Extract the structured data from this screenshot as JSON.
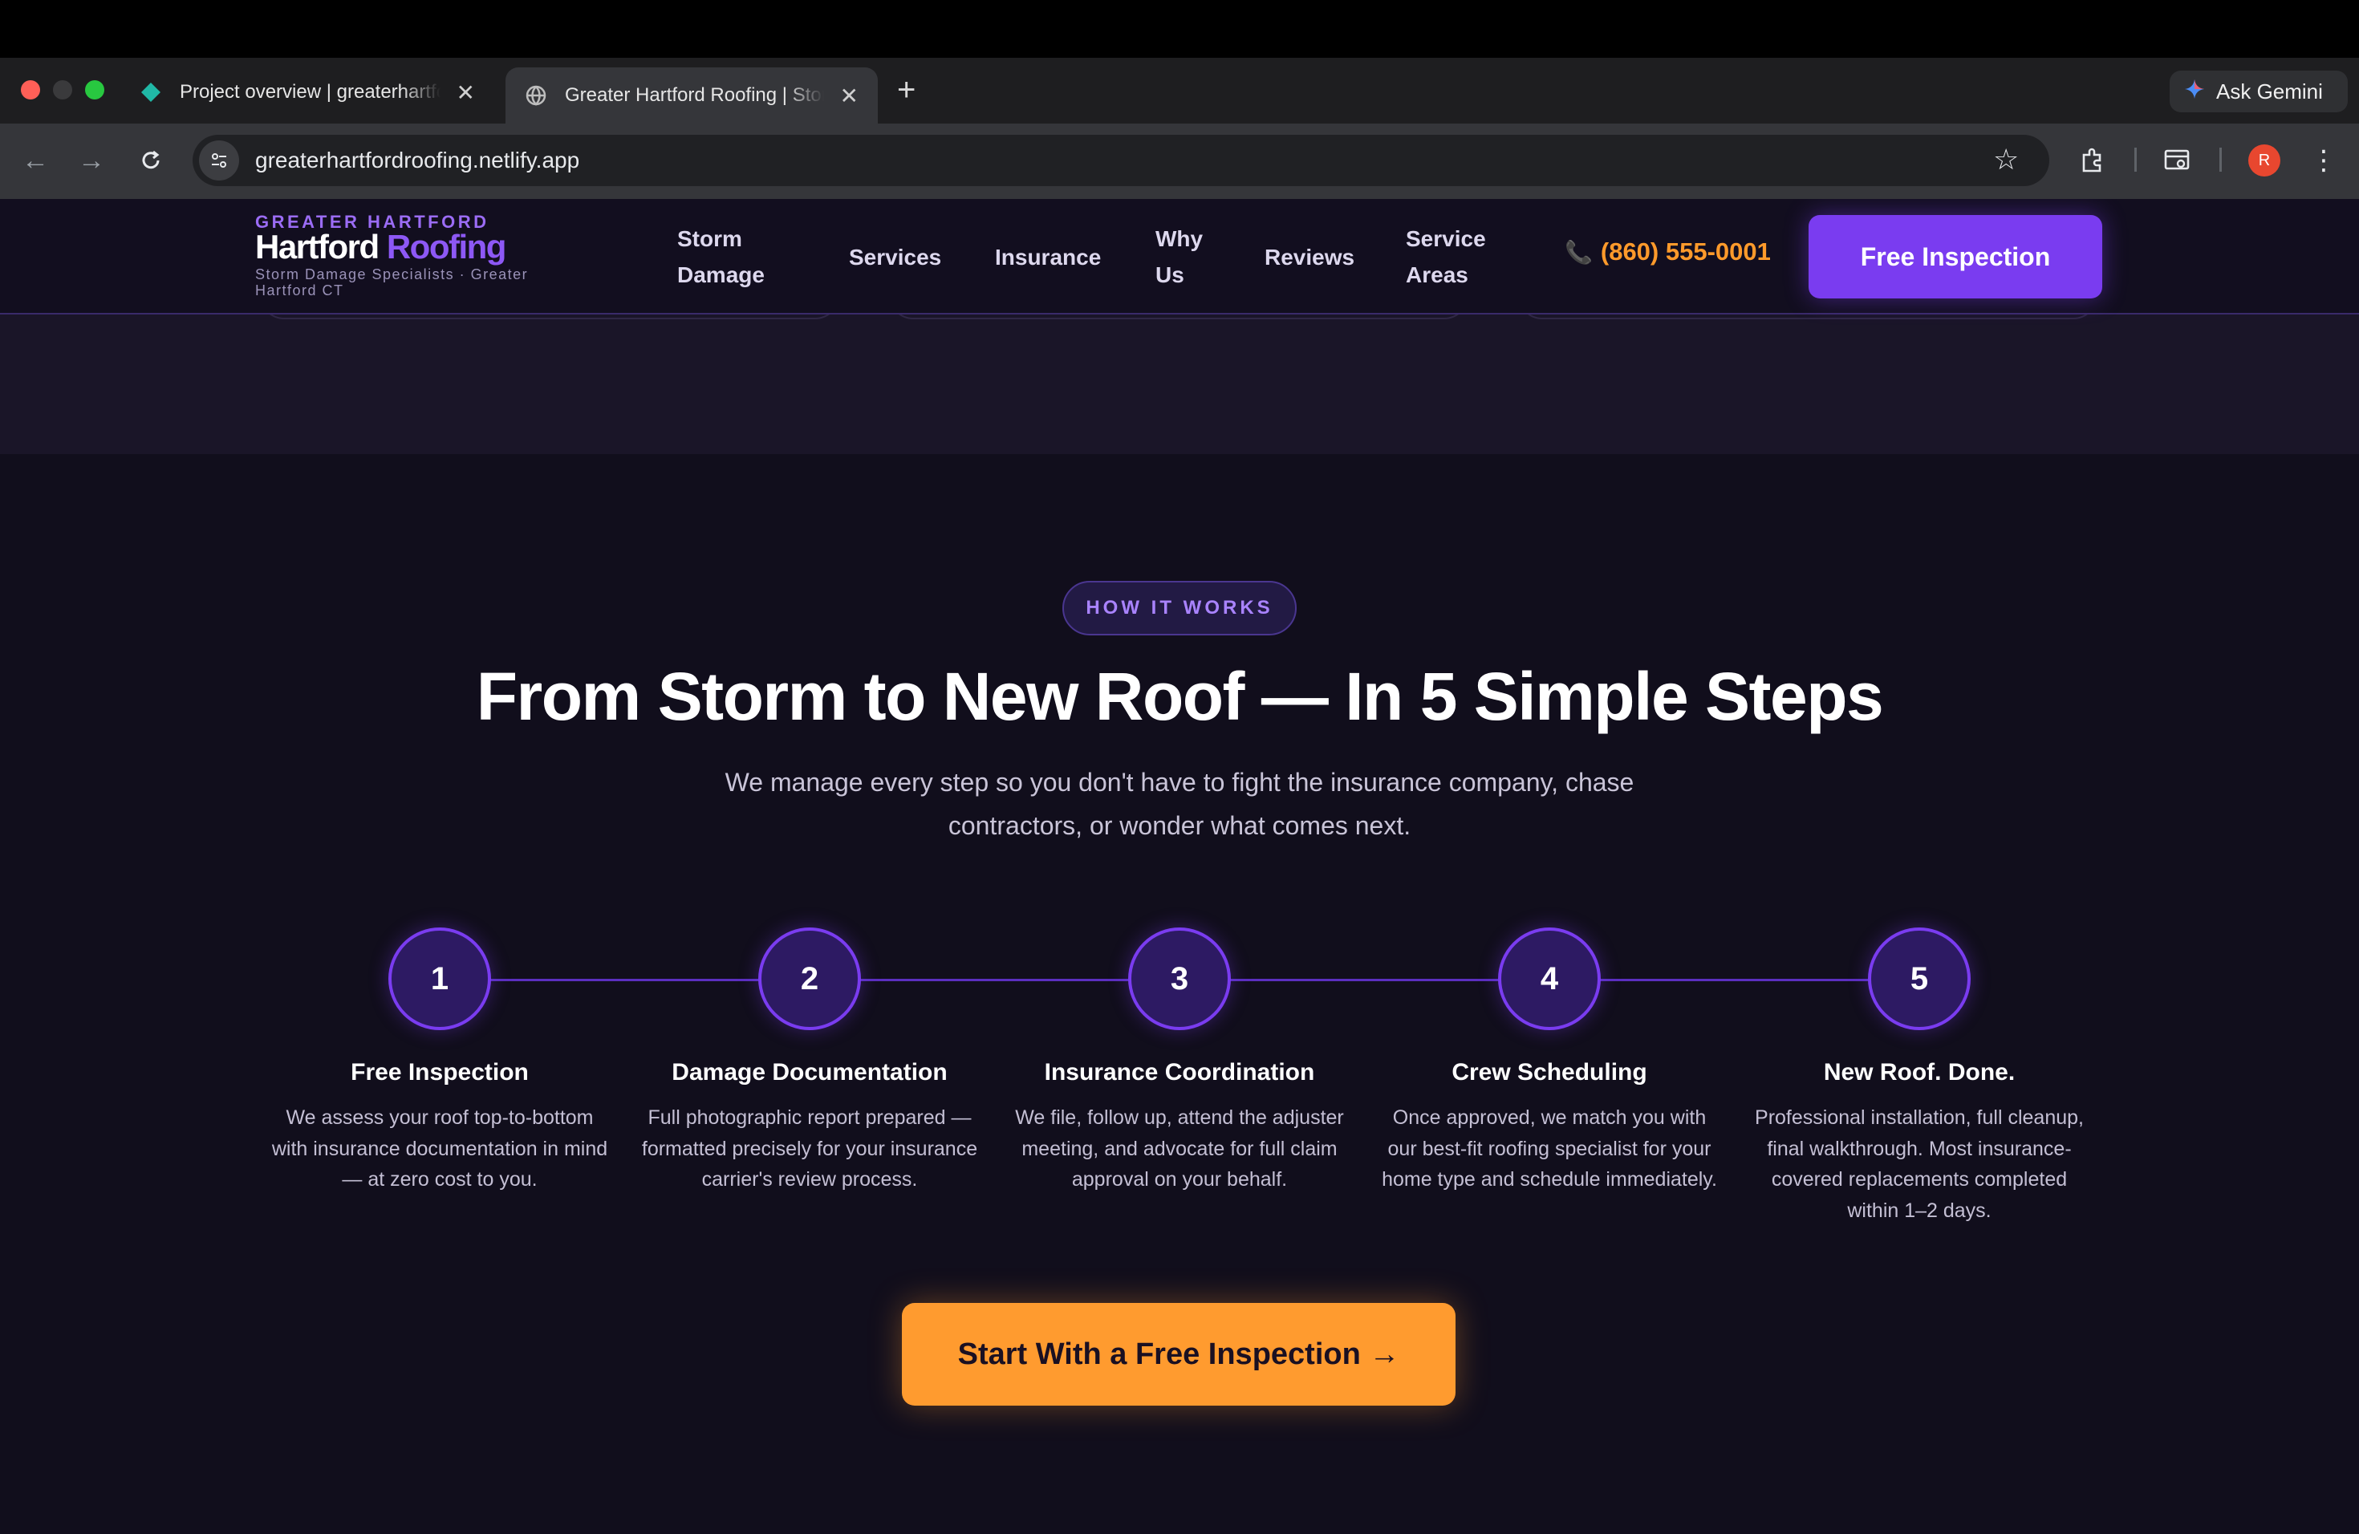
{
  "browser": {
    "tabs": [
      {
        "title": "Project overview | greaterhartfordroofing",
        "active": false
      },
      {
        "title": "Greater Hartford Roofing | Storm Damage",
        "active": true
      }
    ],
    "new_tab": "+",
    "ask_gemini": "Ask Gemini",
    "url": "greaterhartfordroofing.netlify.app",
    "profile_initial": "R"
  },
  "nav": {
    "kicker": "GREATER HARTFORD",
    "logo_white": "Hartford ",
    "logo_purple": "Roofing",
    "tagline": "Storm Damage Specialists · Greater Hartford CT",
    "links": [
      {
        "line1": "Storm",
        "line2": "Damage"
      },
      {
        "line1": "Services",
        "line2": ""
      },
      {
        "line1": "Insurance",
        "line2": ""
      },
      {
        "line1": "Why",
        "line2": "Us"
      },
      {
        "line1": "Reviews",
        "line2": ""
      },
      {
        "line1": "Service",
        "line2": "Areas"
      }
    ],
    "phone": "(860) 555-0001",
    "cta": "Free Inspection"
  },
  "how": {
    "eyebrow": "HOW IT WORKS",
    "heading": "From Storm to New Roof — In 5 Simple Steps",
    "lead": "We manage every step so you don't have to fight the insurance company, chase contractors, or wonder what comes next.",
    "steps": [
      {
        "num": "1",
        "title": "Free Inspection",
        "desc": "We assess your roof top-to-bottom with insurance documentation in mind — at zero cost to you."
      },
      {
        "num": "2",
        "title": "Damage Documentation",
        "desc": "Full photographic report prepared — formatted precisely for your insurance carrier's review process."
      },
      {
        "num": "3",
        "title": "Insurance Coordination",
        "desc": "We file, follow up, attend the adjuster meeting, and advocate for full claim approval on your behalf."
      },
      {
        "num": "4",
        "title": "Crew Scheduling",
        "desc": "Once approved, we match you with our best-fit roofing specialist for your home type and schedule immediately."
      },
      {
        "num": "5",
        "title": "New Roof. Done.",
        "desc": "Professional installation, full cleanup, final walkthrough. Most insurance-covered replacements completed within 1–2 days."
      }
    ],
    "cta": "Start With a Free Inspection →"
  }
}
